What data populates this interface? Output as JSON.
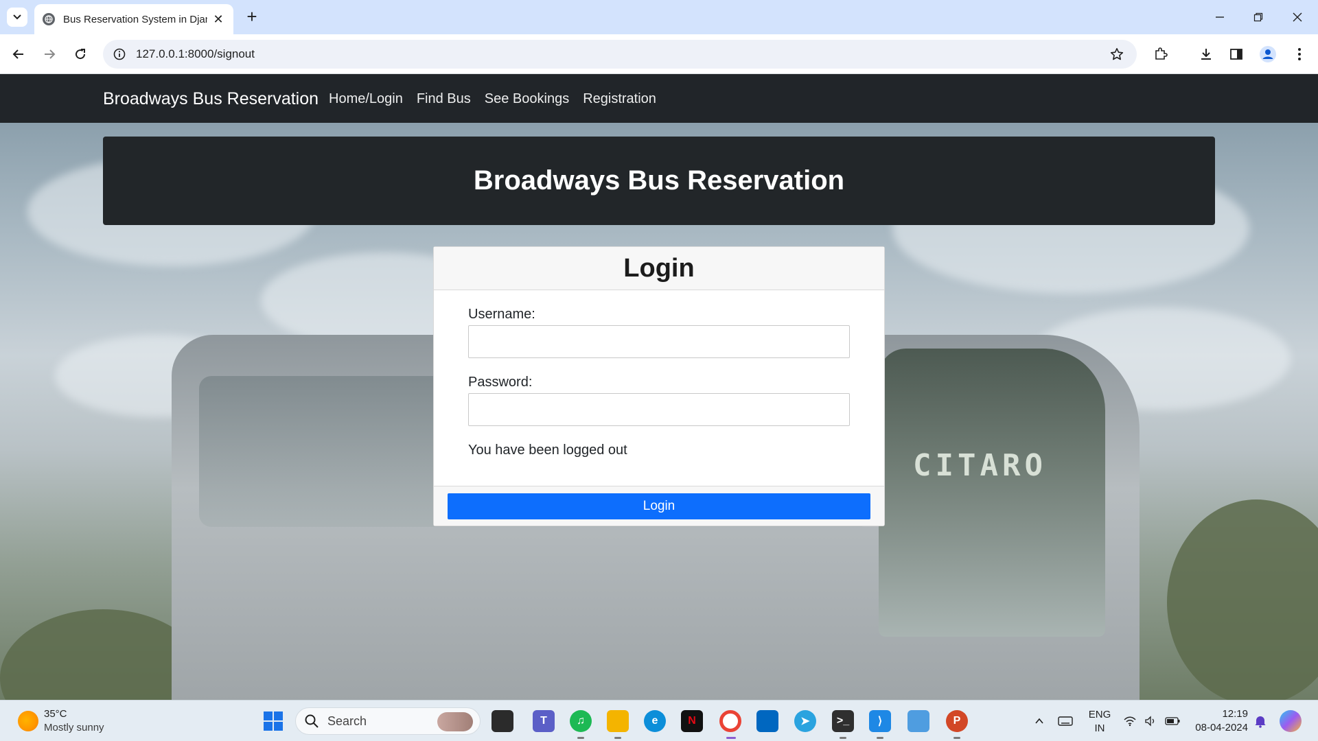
{
  "browser": {
    "tab_title": "Bus Reservation System in Djan",
    "url": "127.0.0.1:8000/signout"
  },
  "navbar": {
    "brand": "Broadways Bus Reservation",
    "links": [
      "Home/Login",
      "Find Bus",
      "See Bookings",
      "Registration"
    ]
  },
  "hero": {
    "title": "Broadways Bus Reservation"
  },
  "bus_sign": "CITARO",
  "login_card": {
    "title": "Login",
    "username_label": "Username:",
    "username_value": "",
    "password_label": "Password:",
    "password_value": "",
    "message": "You have been logged out",
    "submit_label": "Login"
  },
  "taskbar": {
    "weather_temp": "35°C",
    "weather_desc": "Mostly sunny",
    "search_placeholder": "Search",
    "language_line1": "ENG",
    "language_line2": "IN",
    "time": "12:19",
    "date": "08-04-2024"
  },
  "colors": {
    "navbar_bg": "#212529",
    "primary_button": "#0d6efd",
    "tabstrip_bg": "#d3e3fd"
  }
}
